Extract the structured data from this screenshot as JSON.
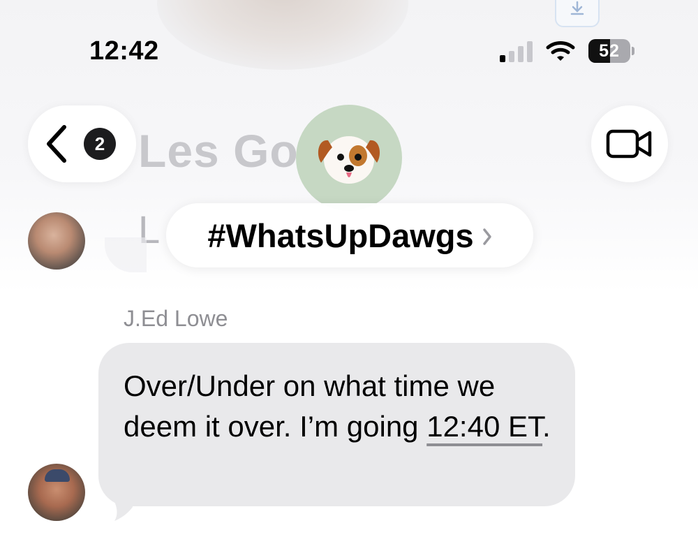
{
  "status_bar": {
    "time": "12:42",
    "battery_level": "52",
    "signal_bars_active": 1,
    "signal_bars_total": 4,
    "icons": [
      "signal-icon",
      "wifi-icon",
      "battery-icon"
    ]
  },
  "header": {
    "back_badge_count": "2",
    "group_name": "#WhatsUpDawgs",
    "group_avatar_emoji": "🐶",
    "background_text_1": "Les Go",
    "background_text_2": "L",
    "icons": [
      "chevron-left-icon",
      "video-camera-icon",
      "chevron-right-icon"
    ]
  },
  "messages": [
    {
      "sender": "J.Ed Lowe",
      "text_before_link": "Over/Under on what time we deem it over. I’m going ",
      "link_text": "12:40 ET",
      "text_after_link": "."
    }
  ],
  "colors": {
    "bubble_gray": "#e9e9eb",
    "sender_gray": "#8e8e93",
    "avatar_green": "#c6d8c3"
  }
}
